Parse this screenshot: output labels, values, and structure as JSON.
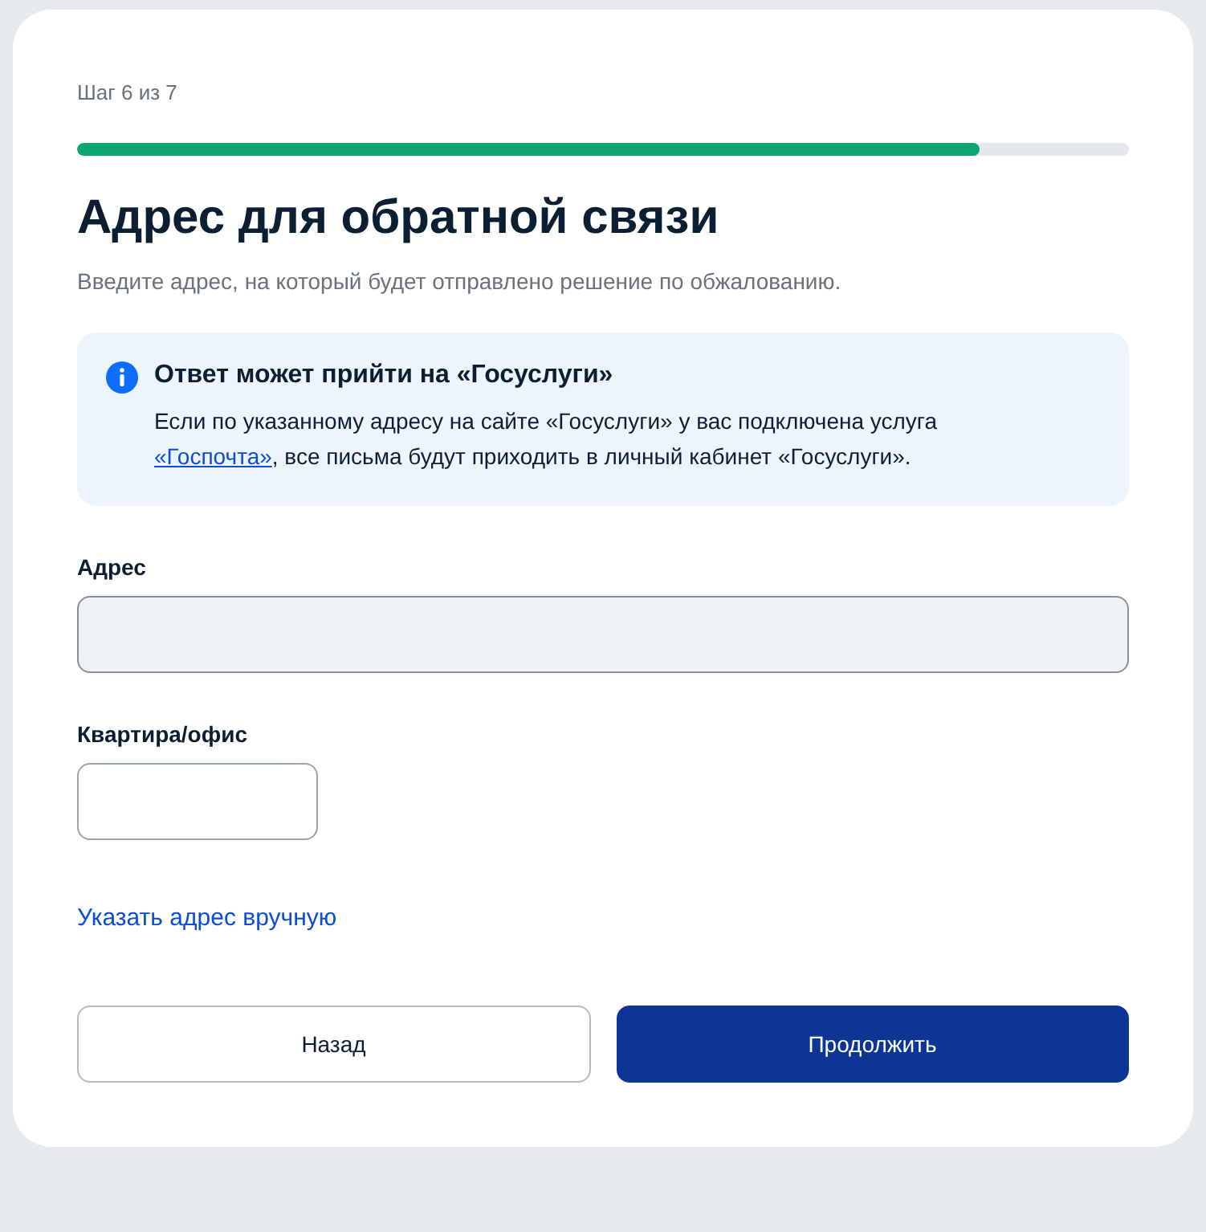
{
  "step": {
    "label": "Шаг 6 из 7",
    "level": 0.858
  },
  "title": "Адрес для обратной связи",
  "subtitle": "Введите адрес, на который будет отправлено решение по обжалованию.",
  "notice": {
    "title": "Ответ может прийти на «Госуслуги»",
    "text_before": "Если по указанному адресу на сайте «Госуслуги» у вас подключена услуга ",
    "link": "«Госпочта»",
    "text_after": ", все письма будут приходить в личный кабинет «Госуслуги»."
  },
  "fields": [
    {
      "label": "Адрес",
      "kind": "wide",
      "disabled": true
    },
    {
      "label": "Квартира/офис",
      "kind": "short",
      "disabled": false
    }
  ],
  "manual_link": "Указать адрес вручную",
  "buttons": [
    {
      "label": "Назад",
      "kind": "secondary"
    },
    {
      "label": "Продолжить",
      "kind": "primary"
    }
  ]
}
